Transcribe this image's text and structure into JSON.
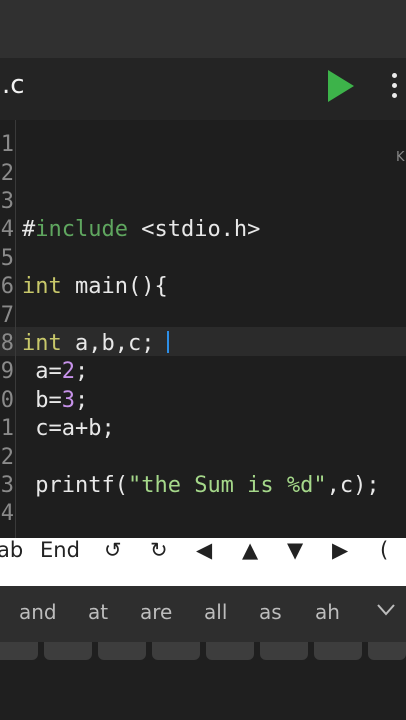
{
  "toolbar": {
    "file_title": ".c"
  },
  "editor": {
    "line_numbers": [
      "1",
      "2",
      "3",
      "4",
      "5",
      "6",
      "7",
      "8",
      "9",
      "0",
      "1",
      "2",
      "3",
      "4"
    ],
    "edge_letter": "K",
    "lines": [
      "",
      "",
      "",
      "#include <stdio.h>",
      "",
      "int main(){",
      "",
      "int a,b,c;",
      " a=2;",
      " b=3;",
      " c=a+b;",
      "",
      " printf(\"the Sum is %d\",c);",
      ""
    ]
  },
  "extra_keys": [
    "ab",
    "End",
    "↺",
    "↻",
    "◀",
    "▲",
    "▼",
    "▶",
    "("
  ],
  "suggestions": [
    "and",
    "at",
    "are",
    "all",
    "as",
    "ah"
  ],
  "colors": {
    "run_green": "#3db34a",
    "cursor": "#2d8fe8",
    "keyword": "#c8c86a",
    "include": "#5fa65f",
    "number": "#c792ea",
    "string": "#a5d88a"
  }
}
